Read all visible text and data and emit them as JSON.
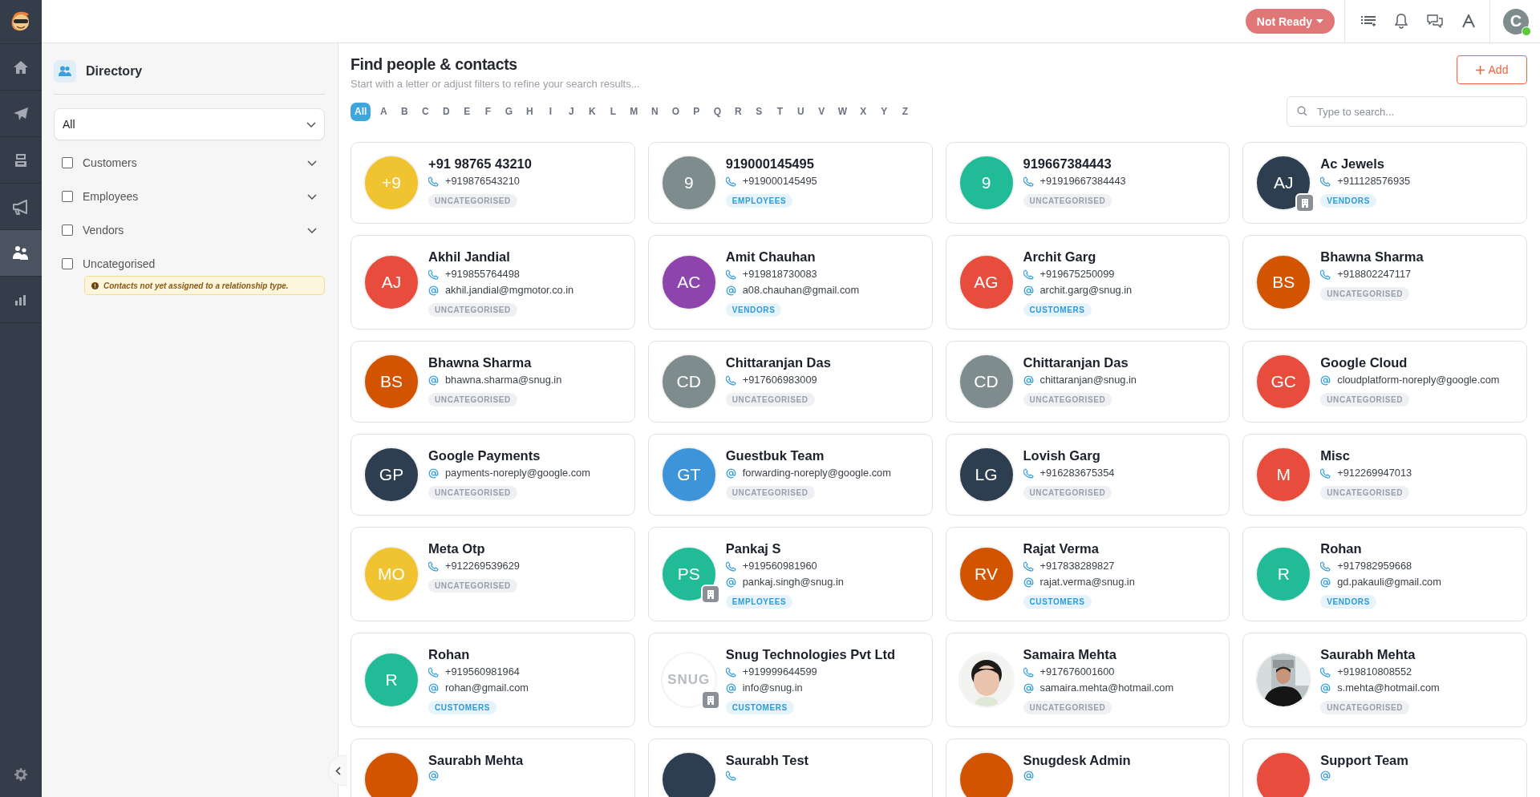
{
  "rail": {
    "items": [
      {
        "kind": "home",
        "selected": false
      },
      {
        "kind": "send",
        "selected": false
      },
      {
        "kind": "inbox",
        "selected": false
      },
      {
        "kind": "campaigns",
        "selected": false
      },
      {
        "kind": "contacts",
        "selected": true
      },
      {
        "kind": "reports",
        "selected": false
      }
    ]
  },
  "top_bar": {
    "status": {
      "label": "Not Ready"
    },
    "user": {
      "initial": "C",
      "online": true
    }
  },
  "directory": {
    "title": "Directory",
    "select": {
      "value": "All"
    },
    "filters": [
      {
        "label": "Customers",
        "checked": false,
        "expandable": true
      },
      {
        "label": "Employees",
        "checked": false,
        "expandable": true
      },
      {
        "label": "Vendors",
        "checked": false,
        "expandable": true
      },
      {
        "label": "Uncategorised",
        "checked": false,
        "expandable": false,
        "note": "Contacts not yet assigned to a relationship type."
      }
    ]
  },
  "main": {
    "title": "Find people & contacts",
    "subtitle": "Start with a letter or adjust filters to refine your search results...",
    "add_button": "Add",
    "search": {
      "placeholder": "Type to search..."
    },
    "letters": [
      {
        "label": "All",
        "selected": true
      },
      {
        "label": "A",
        "selected": false
      },
      {
        "label": "B",
        "selected": false
      },
      {
        "label": "C",
        "selected": false
      },
      {
        "label": "D",
        "selected": false
      },
      {
        "label": "E",
        "selected": false
      },
      {
        "label": "F",
        "selected": false
      },
      {
        "label": "G",
        "selected": false
      },
      {
        "label": "H",
        "selected": false
      },
      {
        "label": "I",
        "selected": false
      },
      {
        "label": "J",
        "selected": false
      },
      {
        "label": "K",
        "selected": false
      },
      {
        "label": "L",
        "selected": false
      },
      {
        "label": "M",
        "selected": false
      },
      {
        "label": "N",
        "selected": false
      },
      {
        "label": "O",
        "selected": false
      },
      {
        "label": "P",
        "selected": false
      },
      {
        "label": "Q",
        "selected": false
      },
      {
        "label": "R",
        "selected": false
      },
      {
        "label": "S",
        "selected": false
      },
      {
        "label": "T",
        "selected": false
      },
      {
        "label": "U",
        "selected": false
      },
      {
        "label": "V",
        "selected": false
      },
      {
        "label": "W",
        "selected": false
      },
      {
        "label": "X",
        "selected": false
      },
      {
        "label": "Y",
        "selected": false
      },
      {
        "label": "Z",
        "selected": false
      }
    ]
  },
  "contacts": [
    {
      "name": "+91 98765 43210",
      "avatar": {
        "kind": "initials",
        "text": "+9",
        "color": "#f0c431",
        "badge": false
      },
      "lines": [
        {
          "kind": "phone",
          "text": "+919876543210"
        }
      ],
      "tag": {
        "label": "UNCATEGORISED",
        "kind": "uncategorised"
      }
    },
    {
      "name": "919000145495",
      "avatar": {
        "kind": "initials",
        "text": "9",
        "color": "#7f8c8d",
        "badge": false
      },
      "lines": [
        {
          "kind": "phone",
          "text": "+919000145495"
        }
      ],
      "tag": {
        "label": "EMPLOYEES",
        "kind": "relationship"
      }
    },
    {
      "name": "919667384443",
      "avatar": {
        "kind": "initials",
        "text": "9",
        "color": "#22bb98",
        "badge": false
      },
      "lines": [
        {
          "kind": "phone",
          "text": "+91919667384443"
        }
      ],
      "tag": {
        "label": "UNCATEGORISED",
        "kind": "uncategorised"
      }
    },
    {
      "name": "Ac Jewels",
      "avatar": {
        "kind": "initials",
        "text": "AJ",
        "color": "#2c3e50",
        "badge": true
      },
      "lines": [
        {
          "kind": "phone",
          "text": "+911128576935"
        }
      ],
      "tag": {
        "label": "VENDORS",
        "kind": "relationship"
      }
    },
    {
      "name": "Akhil Jandial",
      "avatar": {
        "kind": "initials",
        "text": "AJ",
        "color": "#e74c3c",
        "badge": false
      },
      "lines": [
        {
          "kind": "phone",
          "text": "+919855764498"
        },
        {
          "kind": "email",
          "text": "akhil.jandial@mgmotor.co.in"
        }
      ],
      "tag": {
        "label": "UNCATEGORISED",
        "kind": "uncategorised"
      }
    },
    {
      "name": "Amit Chauhan",
      "avatar": {
        "kind": "initials",
        "text": "AC",
        "color": "#8e44ad",
        "badge": false
      },
      "lines": [
        {
          "kind": "phone",
          "text": "+919818730083"
        },
        {
          "kind": "email",
          "text": "a08.chauhan@gmail.com"
        }
      ],
      "tag": {
        "label": "VENDORS",
        "kind": "relationship"
      }
    },
    {
      "name": "Archit Garg",
      "avatar": {
        "kind": "initials",
        "text": "AG",
        "color": "#e74c3c",
        "badge": false
      },
      "lines": [
        {
          "kind": "phone",
          "text": "+919675250099"
        },
        {
          "kind": "email",
          "text": "archit.garg@snug.in"
        }
      ],
      "tag": {
        "label": "CUSTOMERS",
        "kind": "relationship"
      }
    },
    {
      "name": "Bhawna Sharma",
      "avatar": {
        "kind": "initials",
        "text": "BS",
        "color": "#d35400",
        "badge": false
      },
      "lines": [
        {
          "kind": "phone",
          "text": "+918802247117"
        }
      ],
      "tag": {
        "label": "UNCATEGORISED",
        "kind": "uncategorised"
      }
    },
    {
      "name": "Bhawna Sharma",
      "avatar": {
        "kind": "initials",
        "text": "BS",
        "color": "#d35400",
        "badge": false
      },
      "lines": [
        {
          "kind": "email",
          "text": "bhawna.sharma@snug.in"
        }
      ],
      "tag": {
        "label": "UNCATEGORISED",
        "kind": "uncategorised"
      }
    },
    {
      "name": "Chittaranjan Das",
      "avatar": {
        "kind": "initials",
        "text": "CD",
        "color": "#7f8c8d",
        "badge": false
      },
      "lines": [
        {
          "kind": "phone",
          "text": "+917606983009"
        }
      ],
      "tag": {
        "label": "UNCATEGORISED",
        "kind": "uncategorised"
      }
    },
    {
      "name": "Chittaranjan Das",
      "avatar": {
        "kind": "initials",
        "text": "CD",
        "color": "#7f8c8d",
        "badge": false
      },
      "lines": [
        {
          "kind": "email",
          "text": "chittaranjan@snug.in"
        }
      ],
      "tag": {
        "label": "UNCATEGORISED",
        "kind": "uncategorised"
      }
    },
    {
      "name": "Google Cloud",
      "avatar": {
        "kind": "initials",
        "text": "GC",
        "color": "#e74c3c",
        "badge": false
      },
      "lines": [
        {
          "kind": "email",
          "text": "cloudplatform-noreply@google.com"
        }
      ],
      "tag": {
        "label": "UNCATEGORISED",
        "kind": "uncategorised"
      }
    },
    {
      "name": "Google Payments",
      "avatar": {
        "kind": "initials",
        "text": "GP",
        "color": "#2c3e50",
        "badge": false
      },
      "lines": [
        {
          "kind": "email",
          "text": "payments-noreply@google.com"
        }
      ],
      "tag": {
        "label": "UNCATEGORISED",
        "kind": "uncategorised"
      }
    },
    {
      "name": "Guestbuk Team",
      "avatar": {
        "kind": "initials",
        "text": "GT",
        "color": "#3d94d8",
        "badge": false
      },
      "lines": [
        {
          "kind": "email",
          "text": "forwarding-noreply@google.com"
        }
      ],
      "tag": {
        "label": "UNCATEGORISED",
        "kind": "uncategorised"
      }
    },
    {
      "name": "Lovish Garg",
      "avatar": {
        "kind": "initials",
        "text": "LG",
        "color": "#2c3e50",
        "badge": false
      },
      "lines": [
        {
          "kind": "phone",
          "text": "+916283675354"
        }
      ],
      "tag": {
        "label": "UNCATEGORISED",
        "kind": "uncategorised"
      }
    },
    {
      "name": "Misc",
      "avatar": {
        "kind": "initials",
        "text": "M",
        "color": "#e74c3c",
        "badge": false
      },
      "lines": [
        {
          "kind": "phone",
          "text": "+912269947013"
        }
      ],
      "tag": {
        "label": "UNCATEGORISED",
        "kind": "uncategorised"
      }
    },
    {
      "name": "Meta Otp",
      "avatar": {
        "kind": "initials",
        "text": "MO",
        "color": "#f0c431",
        "badge": false
      },
      "lines": [
        {
          "kind": "phone",
          "text": "+912269539629"
        }
      ],
      "tag": {
        "label": "UNCATEGORISED",
        "kind": "uncategorised"
      }
    },
    {
      "name": "Pankaj S",
      "avatar": {
        "kind": "initials",
        "text": "PS",
        "color": "#22bb98",
        "badge": true
      },
      "lines": [
        {
          "kind": "phone",
          "text": "+919560981960"
        },
        {
          "kind": "email",
          "text": "pankaj.singh@snug.in"
        }
      ],
      "tag": {
        "label": "EMPLOYEES",
        "kind": "relationship"
      }
    },
    {
      "name": "Rajat Verma",
      "avatar": {
        "kind": "initials",
        "text": "RV",
        "color": "#d35400",
        "badge": false
      },
      "lines": [
        {
          "kind": "phone",
          "text": "+917838289827"
        },
        {
          "kind": "email",
          "text": "rajat.verma@snug.in"
        }
      ],
      "tag": {
        "label": "CUSTOMERS",
        "kind": "relationship"
      }
    },
    {
      "name": "Rohan",
      "avatar": {
        "kind": "initials",
        "text": "R",
        "color": "#22bb98",
        "badge": false
      },
      "lines": [
        {
          "kind": "phone",
          "text": "+917982959668"
        },
        {
          "kind": "email",
          "text": "gd.pakauli@gmail.com"
        }
      ],
      "tag": {
        "label": "VENDORS",
        "kind": "relationship"
      }
    },
    {
      "name": "Rohan",
      "avatar": {
        "kind": "initials",
        "text": "R",
        "color": "#22bb98",
        "badge": false
      },
      "lines": [
        {
          "kind": "phone",
          "text": "+919560981964"
        },
        {
          "kind": "email",
          "text": "rohan@gmail.com"
        }
      ],
      "tag": {
        "label": "CUSTOMERS",
        "kind": "relationship"
      }
    },
    {
      "name": "Snug Technologies Pvt Ltd",
      "avatar": {
        "kind": "logo",
        "text": "SNUG",
        "badge": true
      },
      "lines": [
        {
          "kind": "phone",
          "text": "+919999644599"
        },
        {
          "kind": "email",
          "text": "info@snug.in"
        }
      ],
      "tag": {
        "label": "CUSTOMERS",
        "kind": "relationship"
      }
    },
    {
      "name": "Samaira Mehta",
      "lines": [
        {
          "kind": "phone",
          "text": "+917676001600"
        },
        {
          "kind": "email",
          "text": "samaira.mehta@hotmail.com"
        }
      ],
      "tag": {
        "label": "UNCATEGORISED",
        "kind": "uncategorised"
      }
    },
    {
      "name": "Saurabh Mehta",
      "lines": [
        {
          "kind": "phone",
          "text": "+919810808552"
        },
        {
          "kind": "email",
          "text": "s.mehta@hotmail.com"
        }
      ],
      "tag": {
        "label": "UNCATEGORISED",
        "kind": "uncategorised"
      }
    },
    {
      "name": "Saurabh Mehta",
      "avatar": {
        "kind": "initials",
        "color": "#d35400",
        "badge": false
      },
      "lines": [
        {
          "kind": "email"
        }
      ]
    },
    {
      "name": "Saurabh Test",
      "avatar": {
        "kind": "initials",
        "color": "#2c3e50",
        "badge": false
      },
      "lines": [
        {
          "kind": "phone"
        }
      ]
    },
    {
      "name": "Snugdesk Admin",
      "avatar": {
        "kind": "initials",
        "color": "#d35400",
        "badge": false
      },
      "lines": [
        {
          "kind": "email"
        }
      ]
    },
    {
      "name": "Support Team",
      "avatar": {
        "kind": "initials",
        "color": "#e74c3c",
        "badge": false
      },
      "lines": [
        {
          "kind": "email"
        }
      ]
    }
  ]
}
